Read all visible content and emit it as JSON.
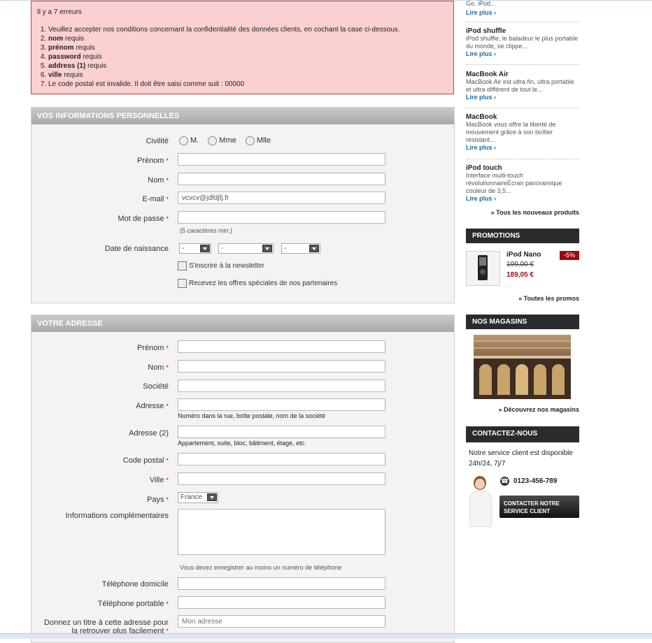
{
  "errors": {
    "title": "Il y a 7 erreurs",
    "items": [
      {
        "b": "",
        "t": "Veuillez accepter nos conditions concernant la confidentialité des données clients, en cochant la case ci-dessous."
      },
      {
        "b": "nom",
        "t": " requis"
      },
      {
        "b": "prénom",
        "t": " requis"
      },
      {
        "b": "password",
        "t": " requis"
      },
      {
        "b": "address (1)",
        "t": " requis"
      },
      {
        "b": "ville",
        "t": " requis"
      },
      {
        "b": "",
        "t": "Le code postal est invalide. Il doit être saisi comme suit : 00000"
      }
    ]
  },
  "personal": {
    "title": "VOS INFORMATIONS PERSONNELLES",
    "civilite_label": "Civilité",
    "civilite_options": [
      "M.",
      "Mme",
      "Mlle"
    ],
    "prenom_label": "Prénom",
    "nom_label": "Nom",
    "email_label": "E-mail",
    "email_value": "vcvcv@jdfdjfj.fr",
    "password_label": "Mot de passe",
    "password_hint": "(5 caractères min.)",
    "birth_label": "Date de naissance",
    "birth_day": "-",
    "birth_month": "-",
    "birth_year": "-",
    "newsletter_label": "S'inscrire à la newsletter",
    "offers_label": "Recevez les offres spéciales de nos partenaires",
    "required_mark": "*"
  },
  "address": {
    "title": "VOTRE ADRESSE",
    "prenom_label": "Prénom",
    "nom_label": "Nom",
    "societe_label": "Société",
    "adresse_label": "Adresse",
    "adresse_hint": "Numéro dans la rue, boîte postale, nom de la société",
    "adresse2_label": "Adresse (2)",
    "adresse2_hint": "Appartement, suite, bloc, bâtiment, étage, etc.",
    "cp_label": "Code postal",
    "ville_label": "Ville",
    "pays_label": "Pays",
    "pays_value": "France",
    "infos_label": "Informations complémentaires",
    "phone_notice": "Vous devez enregistrer au moins un numéro de téléphone",
    "tel_label": "Téléphone domicile",
    "mobile_label": "Téléphone portable",
    "alias_label_1": "Donnez un titre à cette adresse pour",
    "alias_label_2": "la retrouver plus facilement",
    "alias_placeholder": "Mon adresse"
  },
  "sidebar": {
    "top_text": "Go. iPod...",
    "more_label": "Lire plus",
    "products": [
      {
        "name": "iPod shuffle",
        "desc": "iPod shuffle, le baladeur le plus portable du monde, se clippe..."
      },
      {
        "name": "MacBook Air",
        "desc": "MacBook Air est ultra fin, ultra portable et ultra différent de tout le..."
      },
      {
        "name": "MacBook",
        "desc": "MacBook vous offre la liberté de mouvement grâce à son boîtier résistant..."
      },
      {
        "name": "iPod touch",
        "desc": "Interface multi-touch révolutionnaireÉcran panoramique couleur de 3,5..."
      }
    ],
    "all_new": "Tous les nouveaux produits",
    "promo_title": "PROMOTIONS",
    "promo_name": "iPod Nano",
    "promo_badge": "-5%",
    "promo_old": "199,00 €",
    "promo_new": "189,05 €",
    "all_promos": "Toutes les promos",
    "stores_title": "NOS MAGASINS",
    "stores_link": "Découvrez nos magasins",
    "contact_title": "CONTACTEZ-NOUS",
    "contact_text": "Notre service client est disponible 24h/24, 7j/7",
    "phone": "0123-456-789",
    "contact_button": "CONTACTER NOTRE SERVICE CLIENT"
  }
}
